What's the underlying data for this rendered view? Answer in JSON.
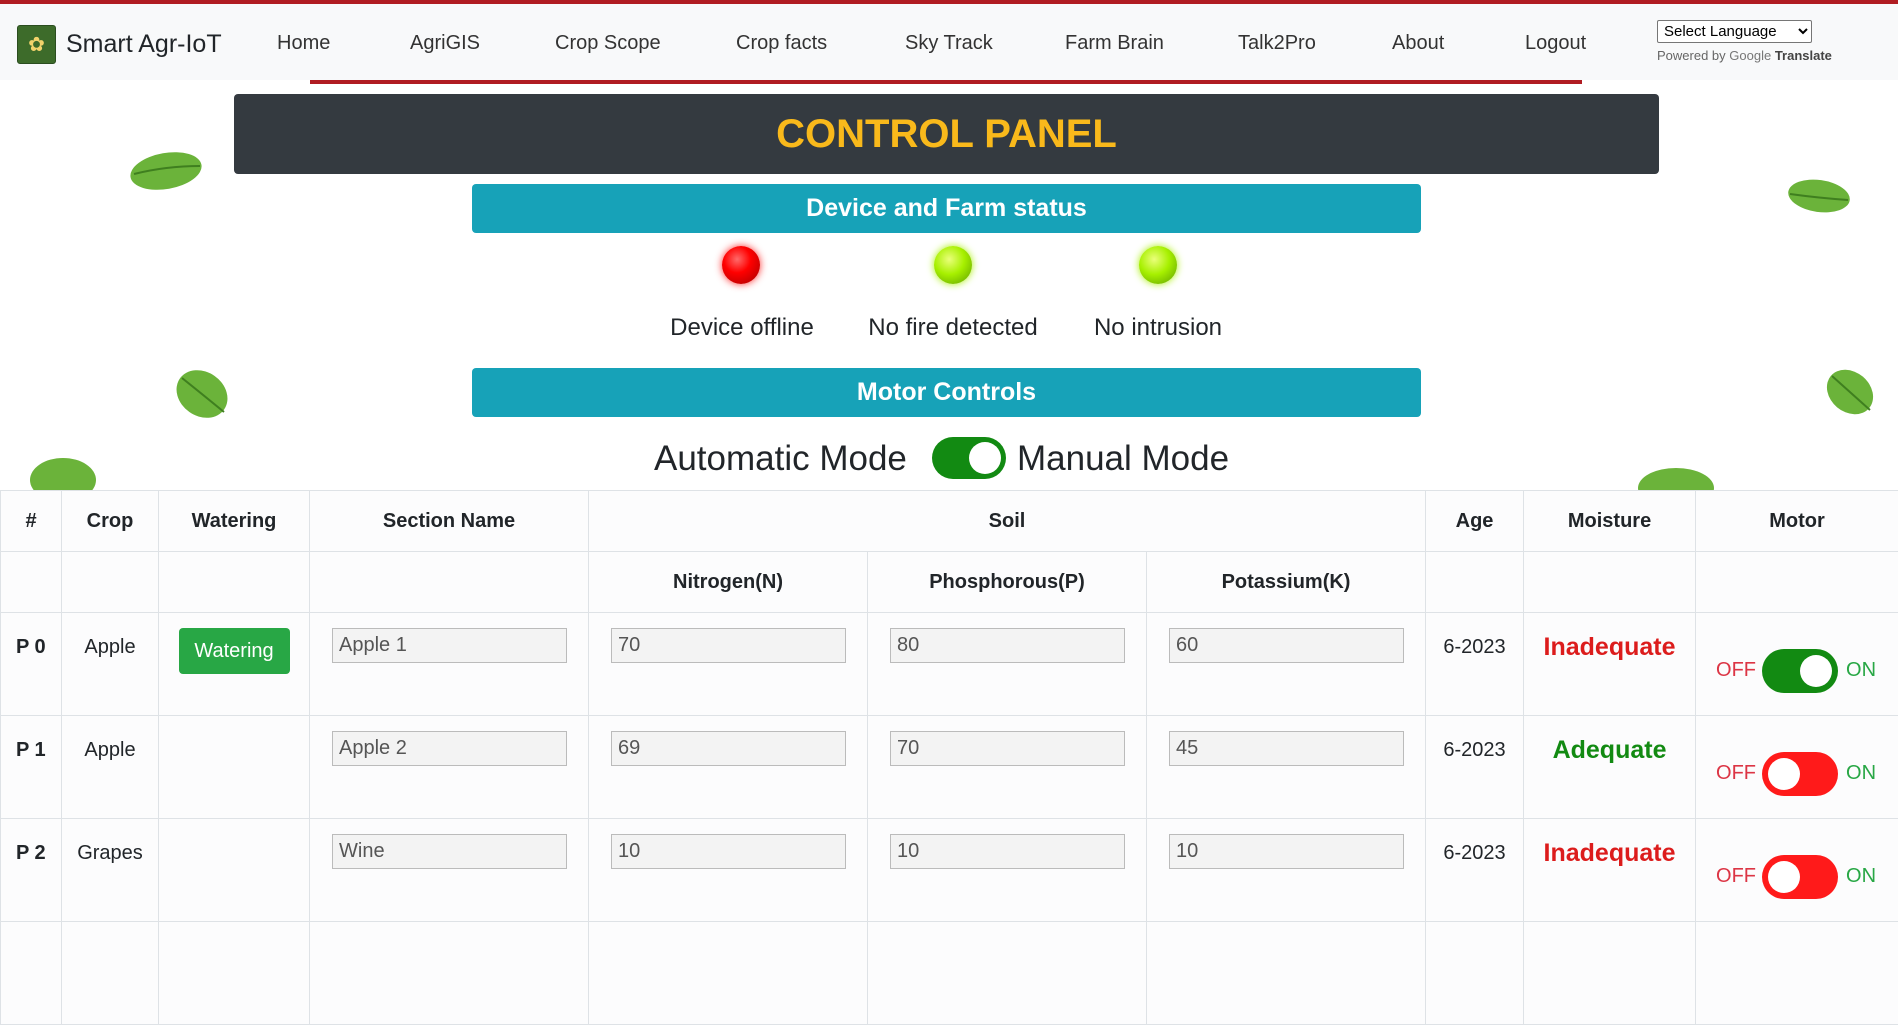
{
  "brand": {
    "name": "Smart Agr-IoT",
    "logo_icon": "farm-logo-icon"
  },
  "nav": [
    {
      "label": "Home"
    },
    {
      "label": "AgriGIS"
    },
    {
      "label": "Crop Scope"
    },
    {
      "label": "Crop facts"
    },
    {
      "label": "Sky Track"
    },
    {
      "label": "Farm Brain"
    },
    {
      "label": "Talk2Pro"
    },
    {
      "label": "About"
    },
    {
      "label": "Logout"
    }
  ],
  "translate": {
    "select_label": "Select Language",
    "powered_by": "Powered by",
    "google": "Google",
    "translate": "Translate"
  },
  "panel": {
    "title": "CONTROL PANEL"
  },
  "status_section": {
    "title": "Device and Farm status",
    "items": [
      {
        "label": "Device offline",
        "state": "red"
      },
      {
        "label": "No fire detected",
        "state": "green"
      },
      {
        "label": "No intrusion",
        "state": "green"
      }
    ]
  },
  "motor_section": {
    "title": "Motor Controls",
    "auto_label": "Automatic Mode",
    "manual_label": "Manual Mode",
    "manual_mode_on": true
  },
  "table": {
    "headers": {
      "id": "#",
      "crop": "Crop",
      "watering": "Watering",
      "section": "Section Name",
      "soil": "Soil",
      "age": "Age",
      "moisture": "Moisture",
      "motor": "Motor",
      "n": "Nitrogen(N)",
      "p": "Phosphorous(P)",
      "k": "Potassium(K)"
    },
    "rows": [
      {
        "id": "P 0",
        "crop": "Apple",
        "watering": "Watering",
        "section": "Apple 1",
        "n": "70",
        "p": "80",
        "k": "60",
        "age": "6-2023",
        "moisture": "Inadequate",
        "motor_on": true,
        "off": "OFF",
        "on": "ON"
      },
      {
        "id": "P 1",
        "crop": "Apple",
        "watering": "",
        "section": "Apple 2",
        "n": "69",
        "p": "70",
        "k": "45",
        "age": "6-2023",
        "moisture": "Adequate",
        "motor_on": false,
        "off": "OFF",
        "on": "ON"
      },
      {
        "id": "P 2",
        "crop": "Grapes",
        "watering": "",
        "section": "Wine",
        "n": "10",
        "p": "10",
        "k": "10",
        "age": "6-2023",
        "moisture": "Inadequate",
        "motor_on": false,
        "off": "OFF",
        "on": "ON"
      }
    ]
  },
  "colors": {
    "panel_title": "#f9b91b",
    "section_bar": "#17a2b8",
    "inadequate": "#dc1c1c",
    "adequate": "#128a12",
    "toggle_on": "#128a12",
    "toggle_off": "#ff1a1a"
  }
}
